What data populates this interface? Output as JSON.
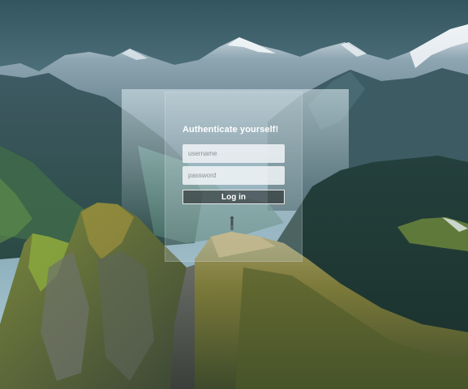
{
  "background": {
    "scene": "mountain-landscape",
    "sky_top": "#33555f",
    "sky_bottom": "#9fc0cc"
  },
  "login": {
    "title": "Authenticate yourself!",
    "username_placeholder": "username",
    "password_placeholder": "password",
    "button_label": "Log in"
  }
}
